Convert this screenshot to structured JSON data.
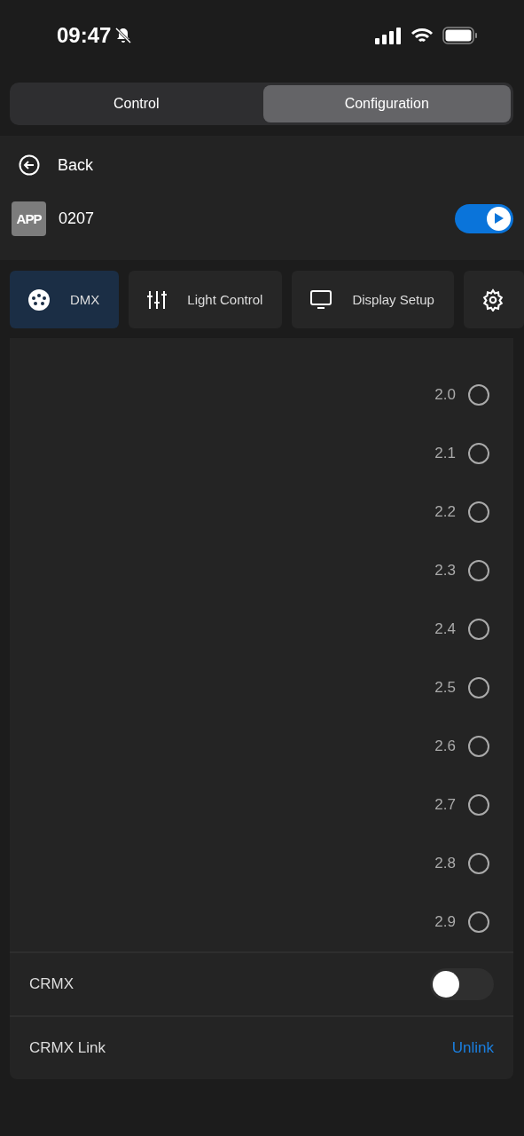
{
  "status_bar": {
    "time": "09:47"
  },
  "segments": [
    {
      "label": "Control",
      "selected": false
    },
    {
      "label": "Configuration",
      "selected": true
    }
  ],
  "back": {
    "label": "Back"
  },
  "device": {
    "badge": "APP",
    "name": "0207",
    "on": true
  },
  "tabs": [
    {
      "label": "DMX",
      "kind": "dmx",
      "selected": true
    },
    {
      "label": "Light Control",
      "kind": "sliders",
      "selected": false
    },
    {
      "label": "Display Setup",
      "kind": "monitor",
      "selected": false
    },
    {
      "kind": "gear",
      "selected": false
    }
  ],
  "options": [
    {
      "label": "2.0",
      "selected": false
    },
    {
      "label": "2.1",
      "selected": false
    },
    {
      "label": "2.2",
      "selected": false
    },
    {
      "label": "2.3",
      "selected": false
    },
    {
      "label": "2.4",
      "selected": false
    },
    {
      "label": "2.5",
      "selected": false
    },
    {
      "label": "2.6",
      "selected": false
    },
    {
      "label": "2.7",
      "selected": false
    },
    {
      "label": "2.8",
      "selected": false
    },
    {
      "label": "2.9",
      "selected": false
    }
  ],
  "settings": [
    {
      "kind": "switch",
      "label": "CRMX",
      "on": false
    },
    {
      "kind": "link",
      "label": "CRMX Link",
      "action": "Unlink"
    }
  ]
}
